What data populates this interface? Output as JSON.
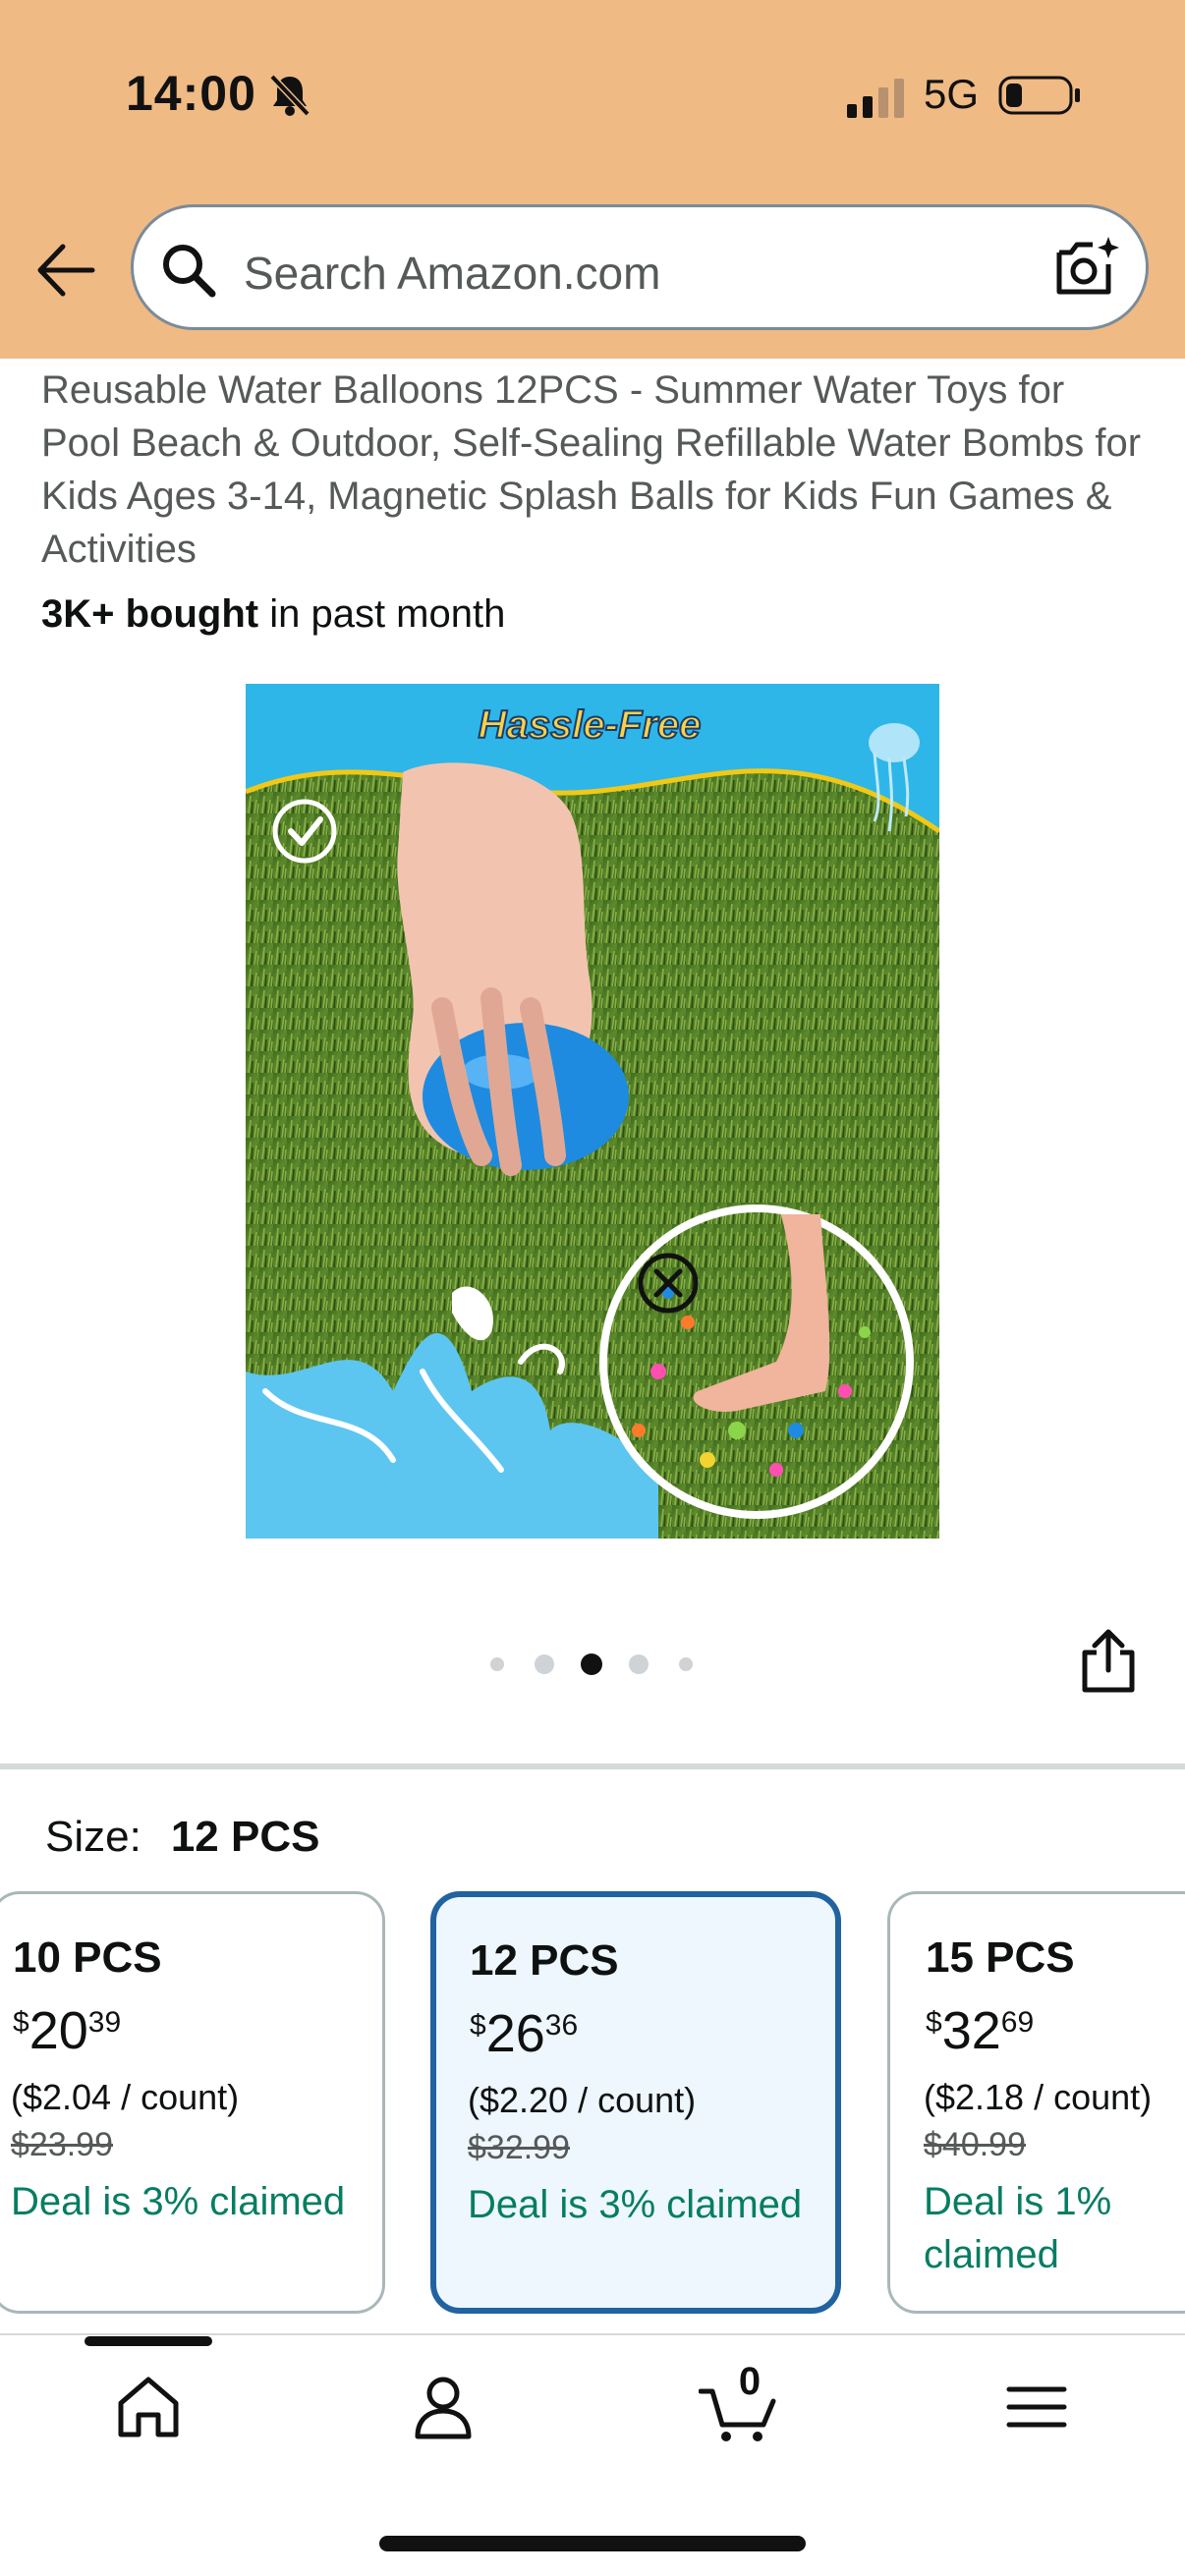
{
  "status_bar": {
    "time": "14:00",
    "network": "5G"
  },
  "search": {
    "placeholder": "Search Amazon.com"
  },
  "product": {
    "title": "Reusable Water Balloons 12PCS - Summer Water Toys for Pool Beach & Outdoor, Self-Sealing Refillable Water Bombs for Kids Ages 3-14, Magnetic Splash Balls for Kids Fun Games & Activities",
    "bought_bold": "3K+ bought",
    "bought_rest": " in past month",
    "image_banner_text": "Hassle-Free",
    "carousel": {
      "count": 5,
      "active_index": 2
    }
  },
  "size": {
    "label": "Size:",
    "selected": "12 PCS",
    "options": [
      {
        "name": "10 PCS",
        "symbol": "$",
        "whole": "20",
        "fraction": "39",
        "unit": "($2.04 / count)",
        "was": "$23.99",
        "deal": "Deal is 3% claimed"
      },
      {
        "name": "12 PCS",
        "symbol": "$",
        "whole": "26",
        "fraction": "36",
        "unit": "($2.20 / count)",
        "was": "$32.99",
        "deal": "Deal is 3% claimed"
      },
      {
        "name": "15 PCS",
        "symbol": "$",
        "whole": "32",
        "fraction": "69",
        "unit": "($2.18 / count)",
        "was": "$40.99",
        "deal": "Deal is 1% claimed"
      }
    ]
  },
  "bottom_nav": {
    "cart_count": "0"
  },
  "colors": {
    "header_bg": "#efba84",
    "selected_border": "#2162a1",
    "selected_bg": "#edf7fd",
    "deal_green": "#067d62"
  },
  "icons": [
    "back-arrow-icon",
    "search-icon",
    "camera-search-icon",
    "share-icon",
    "home-icon",
    "account-icon",
    "cart-icon",
    "menu-icon",
    "bell-slash-icon",
    "signal-icon",
    "battery-icon"
  ]
}
